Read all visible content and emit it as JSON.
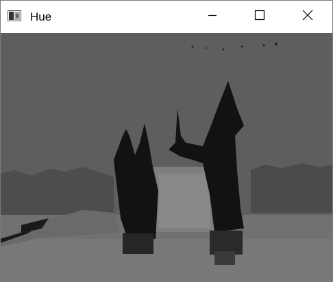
{
  "window": {
    "title": "Hue",
    "app_icon": "opencv-window-icon",
    "controls": {
      "minimize_icon": "minimize-icon",
      "maximize_icon": "maximize-icon",
      "close_icon": "close-icon"
    }
  },
  "image": {
    "subject": "hue-channel-bridge-image",
    "colors": {
      "sky": "#5e5e5e",
      "towers": "#121212",
      "water": "#717171",
      "stone": "#7e7e7e"
    }
  }
}
